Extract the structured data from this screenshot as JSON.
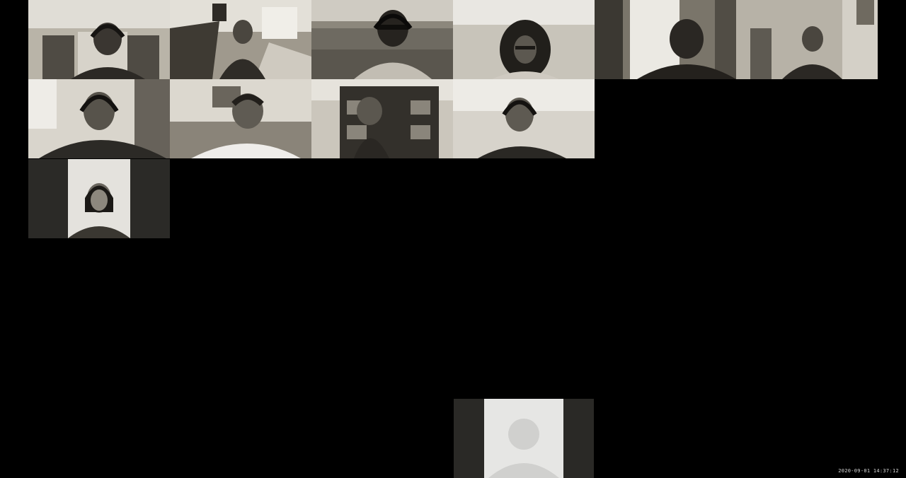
{
  "meeting": {
    "timestamp": "2020-09-01 14:37:12"
  },
  "gallery": {
    "tiles": [
      {
        "id": "participant-1",
        "video": "on",
        "headphones": true
      },
      {
        "id": "participant-2",
        "video": "on",
        "headphones": false
      },
      {
        "id": "participant-3",
        "video": "on",
        "headphones": true
      },
      {
        "id": "participant-4",
        "video": "on",
        "headphones": false
      },
      {
        "id": "participant-5",
        "video": "on",
        "headphones": false
      },
      {
        "id": "participant-6",
        "video": "on",
        "headphones": false
      },
      {
        "id": "participant-7",
        "video": "on",
        "headphones": true
      },
      {
        "id": "participant-8",
        "video": "on",
        "headphones": false
      },
      {
        "id": "participant-9",
        "video": "on",
        "headphones": false
      },
      {
        "id": "participant-10",
        "video": "on",
        "headphones": true
      },
      {
        "id": "participant-11",
        "video": "on",
        "headphones": false
      }
    ],
    "self_view": {
      "video": "off",
      "icon": "person-placeholder-icon"
    }
  },
  "colors": {
    "background": "#000000",
    "video_tone": "#8a8578",
    "placeholder_bg": "#e6e6e4",
    "placeholder_silhouette": "#d0d0ce",
    "timestamp_text": "#d8d8d8"
  }
}
